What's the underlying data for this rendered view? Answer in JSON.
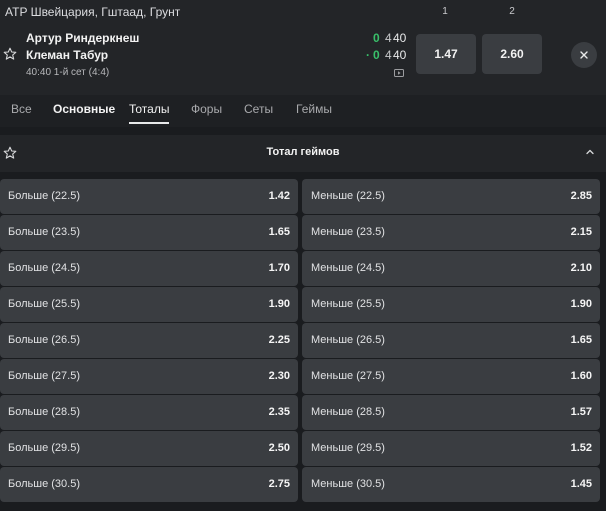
{
  "match": {
    "tournament": "ATP Швейцария, Гштаад, Грунт",
    "col1": "1",
    "col2": "2",
    "player1": "Артур Риндеркнеш",
    "player2": "Клеман Табур",
    "p1_sets": "0",
    "p1_games": "4",
    "p1_points": "40",
    "p2_serve_dot": "·",
    "p2_sets": "0",
    "p2_games": "4",
    "p2_points": "40",
    "info": "40:40 1-й сет (4:4)",
    "odd1": "1.47",
    "odd2": "2.60"
  },
  "tabs": [
    {
      "label": "Все"
    },
    {
      "label": "Основные"
    },
    {
      "label": "Тоталы"
    },
    {
      "label": "Форы"
    },
    {
      "label": "Сеты"
    },
    {
      "label": "Геймы"
    }
  ],
  "market": {
    "title": "Тотал геймов",
    "rows": [
      {
        "over": "Больше (22.5)",
        "over_odd": "1.42",
        "under": "Меньше (22.5)",
        "under_odd": "2.85"
      },
      {
        "over": "Больше (23.5)",
        "over_odd": "1.65",
        "under": "Меньше (23.5)",
        "under_odd": "2.15"
      },
      {
        "over": "Больше (24.5)",
        "over_odd": "1.70",
        "under": "Меньше (24.5)",
        "under_odd": "2.10"
      },
      {
        "over": "Больше (25.5)",
        "over_odd": "1.90",
        "under": "Меньше (25.5)",
        "under_odd": "1.90"
      },
      {
        "over": "Больше (26.5)",
        "over_odd": "2.25",
        "under": "Меньше (26.5)",
        "under_odd": "1.65"
      },
      {
        "over": "Больше (27.5)",
        "over_odd": "2.30",
        "under": "Меньше (27.5)",
        "under_odd": "1.60"
      },
      {
        "over": "Больше (28.5)",
        "over_odd": "2.35",
        "under": "Меньше (28.5)",
        "under_odd": "1.57"
      },
      {
        "over": "Больше (29.5)",
        "over_odd": "2.50",
        "under": "Меньше (29.5)",
        "under_odd": "1.52"
      },
      {
        "over": "Больше (30.5)",
        "over_odd": "2.75",
        "under": "Меньше (30.5)",
        "under_odd": "1.45"
      }
    ]
  },
  "colors": {
    "background": "#1a1c1f",
    "panel": "#232528",
    "button": "#3a3d41",
    "score_green": "#39c06a"
  },
  "icons": {
    "favorite": "star-icon",
    "close": "close-icon",
    "video": "video-icon",
    "collapse": "chevron-up-icon"
  }
}
